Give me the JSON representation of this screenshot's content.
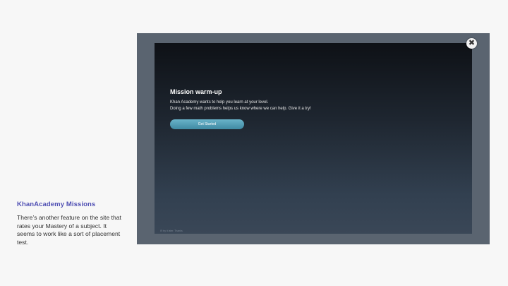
{
  "caption": {
    "title": "KhanAcademy Missions",
    "body": "There’s another feature on the site that rates your Mastery of a subject. It seems to work like a sort of placement test."
  },
  "modal": {
    "heading": "Mission warm-up",
    "line1": "Khan Academy wants to help you learn at your level.",
    "line2": "Doing a few math problems helps us know where we can help. Give it a try!",
    "button_label": "Get Started",
    "close_symbol": "✖",
    "footer": "I'll try it later. Thanks"
  },
  "colors": {
    "caption_title": "#4f4fb3",
    "button": "#4f9db5",
    "overlay": "#5a6470",
    "modal_top": "#0e1116",
    "modal_bottom": "#3a4757"
  }
}
